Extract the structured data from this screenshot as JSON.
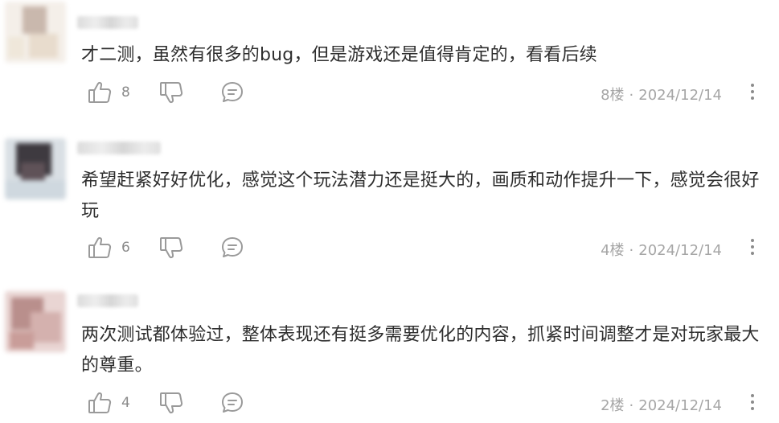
{
  "comments": [
    {
      "username": "████",
      "content": "才二测，虽然有很多的bug，但是游戏还是值得肯定的，看看后续",
      "likes": "8",
      "floor": "8楼",
      "separator": "·",
      "date": "2024/12/14"
    },
    {
      "username": "██████",
      "content": "希望赶紧好好优化，感觉这个玩法潜力还是挺大的，画质和动作提升一下，感觉会很好玩",
      "likes": "6",
      "floor": "4楼",
      "separator": "·",
      "date": "2024/12/14"
    },
    {
      "username": "█████",
      "content": "两次测试都体验过，整体表现还有挺多需要优化的内容，抓紧时间调整才是对玩家最大的尊重。",
      "likes": "4",
      "floor": "2楼",
      "separator": "·",
      "date": "2024/12/14"
    }
  ],
  "icons": {
    "like": "thumbs-up-icon",
    "dislike": "thumbs-down-icon",
    "reply": "speech-bubble-icon",
    "more": "more-vertical-icon"
  },
  "colors": {
    "icon": "#9a9a9a",
    "text": "#2e2e2e",
    "meta": "#a6a6a6"
  }
}
